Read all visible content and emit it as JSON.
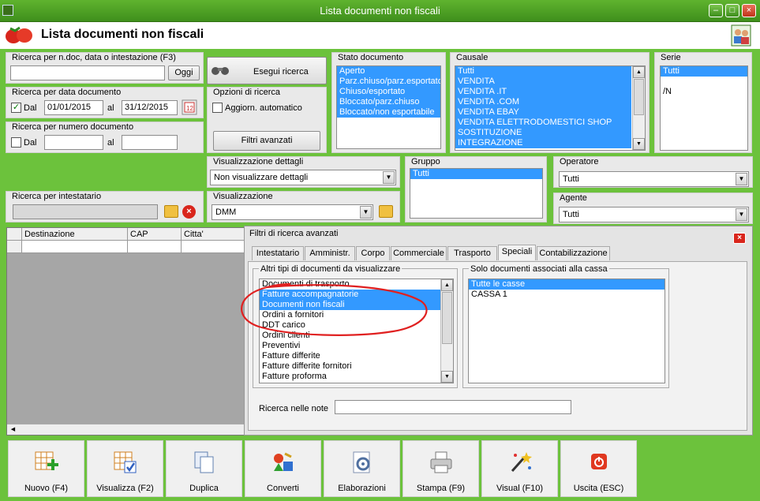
{
  "window": {
    "title": "Lista documenti non fiscali",
    "min": "–",
    "max": "□",
    "close": "×"
  },
  "header": {
    "title": "Lista documenti non fiscali"
  },
  "search_ndoc": {
    "label": "Ricerca per n.doc, data o intestazione (F3)",
    "value": "",
    "button": "Oggi"
  },
  "search_date": {
    "label": "Ricerca per data documento",
    "from_label": "Dal",
    "from": "01/01/2015",
    "to_label": "al",
    "to": "31/12/2015",
    "checked": true
  },
  "search_num": {
    "label": "Ricerca per numero documento",
    "from_label": "Dal",
    "to_label": "al",
    "from": "",
    "to": "",
    "checked": false
  },
  "search_holder": {
    "label": "Ricerca per intestatario",
    "value": ""
  },
  "execute": {
    "label": "Esegui ricerca"
  },
  "options": {
    "label": "Opzioni di ricerca",
    "auto_update": "Aggiorn. automatico",
    "advanced": "Filtri avanzati"
  },
  "stato": {
    "label": "Stato documento",
    "items": [
      "Aperto",
      "Parz.chiuso/parz.esportato",
      "Chiuso/esportato",
      "Bloccato/parz.chiuso",
      "Bloccato/non esportabile"
    ]
  },
  "causale": {
    "label": "Causale",
    "items": [
      "Tutti",
      "VENDITA",
      "VENDITA .IT",
      "VENDITA .COM",
      "VENDITA EBAY",
      "VENDITA ELETTRODOMESTICI SHOP",
      "SOSTITUZIONE",
      "INTEGRAZIONE"
    ]
  },
  "serie": {
    "label": "Serie",
    "items": [
      "Tutti",
      "",
      "/N"
    ]
  },
  "vis_dettagli": {
    "label": "Visualizzazione dettagli",
    "value": "Non visualizzare dettagli"
  },
  "visualizzazione": {
    "label": "Visualizzazione",
    "value": "DMM"
  },
  "gruppo": {
    "label": "Gruppo",
    "items": [
      "Tutti"
    ]
  },
  "operatore": {
    "label": "Operatore",
    "value": "Tutti"
  },
  "agente": {
    "label": "Agente",
    "value": "Tutti"
  },
  "grid": {
    "columns": [
      "Destinazione",
      "CAP",
      "Citta'"
    ]
  },
  "adv": {
    "title": "Filtri di ricerca avanzati",
    "tabs": [
      "Intestatario",
      "Amministr.",
      "Corpo",
      "Commerciale",
      "Trasporto",
      "Speciali",
      "Contabilizzazione"
    ],
    "altri_label": "Altri tipi di documenti da visualizzare",
    "altri_items": [
      "Documenti di trasporto",
      "Fatture accompagnatorie",
      "Documenti non fiscali",
      "Ordini a fornitori",
      "DDT carico",
      "Ordini clienti",
      "Preventivi",
      "Fatture differite",
      "Fatture differite fornitori",
      "Fatture proforma"
    ],
    "cassa_label": "Solo documenti associati alla cassa",
    "cassa_items": [
      "Tutte le casse",
      "CASSA 1"
    ],
    "note_label": "Ricerca nelle note",
    "note_value": ""
  },
  "toolbar": [
    "Nuovo (F4)",
    "Visualizza (F2)",
    "Duplica",
    "Converti",
    "Elaborazioni",
    "Stampa (F9)",
    "Visual (F10)",
    "Uscita (ESC)"
  ],
  "colors": {
    "accent": "#6cc23c",
    "selection": "#3399ff",
    "annotation": "#e02020"
  }
}
